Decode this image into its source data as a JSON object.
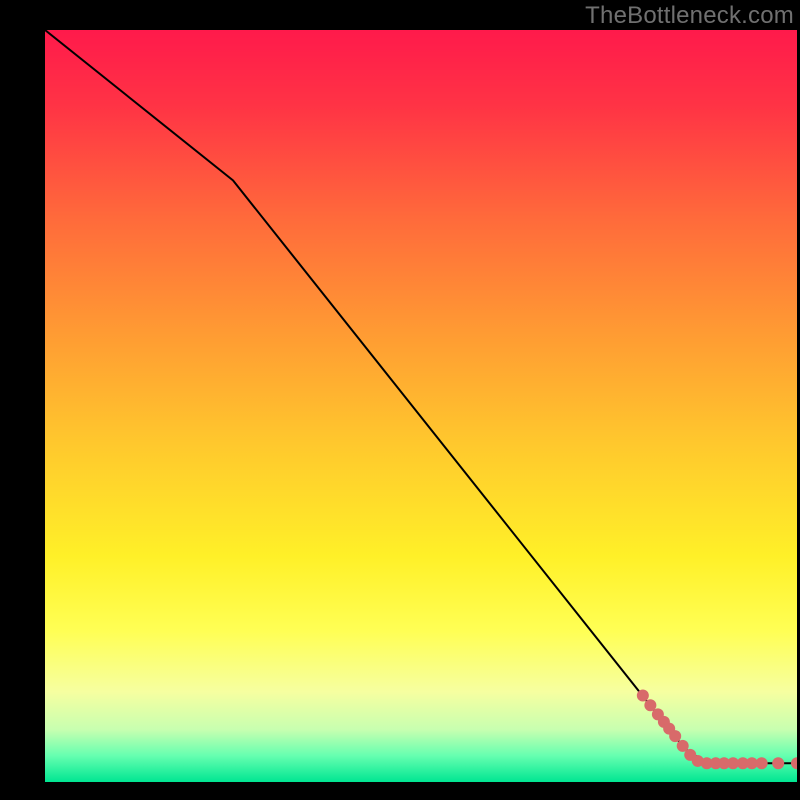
{
  "watermark": "TheBottleneck.com",
  "chart_data": {
    "type": "line",
    "title": "",
    "xlabel": "",
    "ylabel": "",
    "xlim": [
      0,
      100
    ],
    "ylim": [
      0,
      100
    ],
    "grid": false,
    "legend": false,
    "background_gradient_stops": [
      {
        "offset": 0.0,
        "color": "#ff1a4b"
      },
      {
        "offset": 0.1,
        "color": "#ff3345"
      },
      {
        "offset": 0.25,
        "color": "#ff6a3b"
      },
      {
        "offset": 0.4,
        "color": "#ff9a33"
      },
      {
        "offset": 0.55,
        "color": "#ffc82d"
      },
      {
        "offset": 0.7,
        "color": "#fff028"
      },
      {
        "offset": 0.8,
        "color": "#ffff55"
      },
      {
        "offset": 0.88,
        "color": "#f6ffa0"
      },
      {
        "offset": 0.93,
        "color": "#c8ffb0"
      },
      {
        "offset": 0.965,
        "color": "#66ffb0"
      },
      {
        "offset": 1.0,
        "color": "#00e692"
      }
    ],
    "series": [
      {
        "name": "curve",
        "stroke": "#000000",
        "stroke_width": 2,
        "points": [
          {
            "x": 0,
            "y": 100
          },
          {
            "x": 25,
            "y": 80
          },
          {
            "x": 85,
            "y": 4.5
          },
          {
            "x": 88,
            "y": 2.5
          },
          {
            "x": 100,
            "y": 2.5
          }
        ]
      }
    ],
    "scatter": {
      "name": "dots",
      "color": "#d86a6a",
      "radius": 6,
      "points": [
        {
          "x": 79.5,
          "y": 11.5
        },
        {
          "x": 80.5,
          "y": 10.2
        },
        {
          "x": 81.5,
          "y": 9.0
        },
        {
          "x": 82.3,
          "y": 8.0
        },
        {
          "x": 83.0,
          "y": 7.1
        },
        {
          "x": 83.8,
          "y": 6.1
        },
        {
          "x": 84.8,
          "y": 4.8
        },
        {
          "x": 85.8,
          "y": 3.6
        },
        {
          "x": 86.8,
          "y": 2.8
        },
        {
          "x": 88.0,
          "y": 2.5
        },
        {
          "x": 89.2,
          "y": 2.5
        },
        {
          "x": 90.3,
          "y": 2.5
        },
        {
          "x": 91.5,
          "y": 2.5
        },
        {
          "x": 92.8,
          "y": 2.5
        },
        {
          "x": 94.0,
          "y": 2.5
        },
        {
          "x": 95.3,
          "y": 2.5
        },
        {
          "x": 97.5,
          "y": 2.5
        },
        {
          "x": 100.0,
          "y": 2.5
        }
      ]
    }
  }
}
